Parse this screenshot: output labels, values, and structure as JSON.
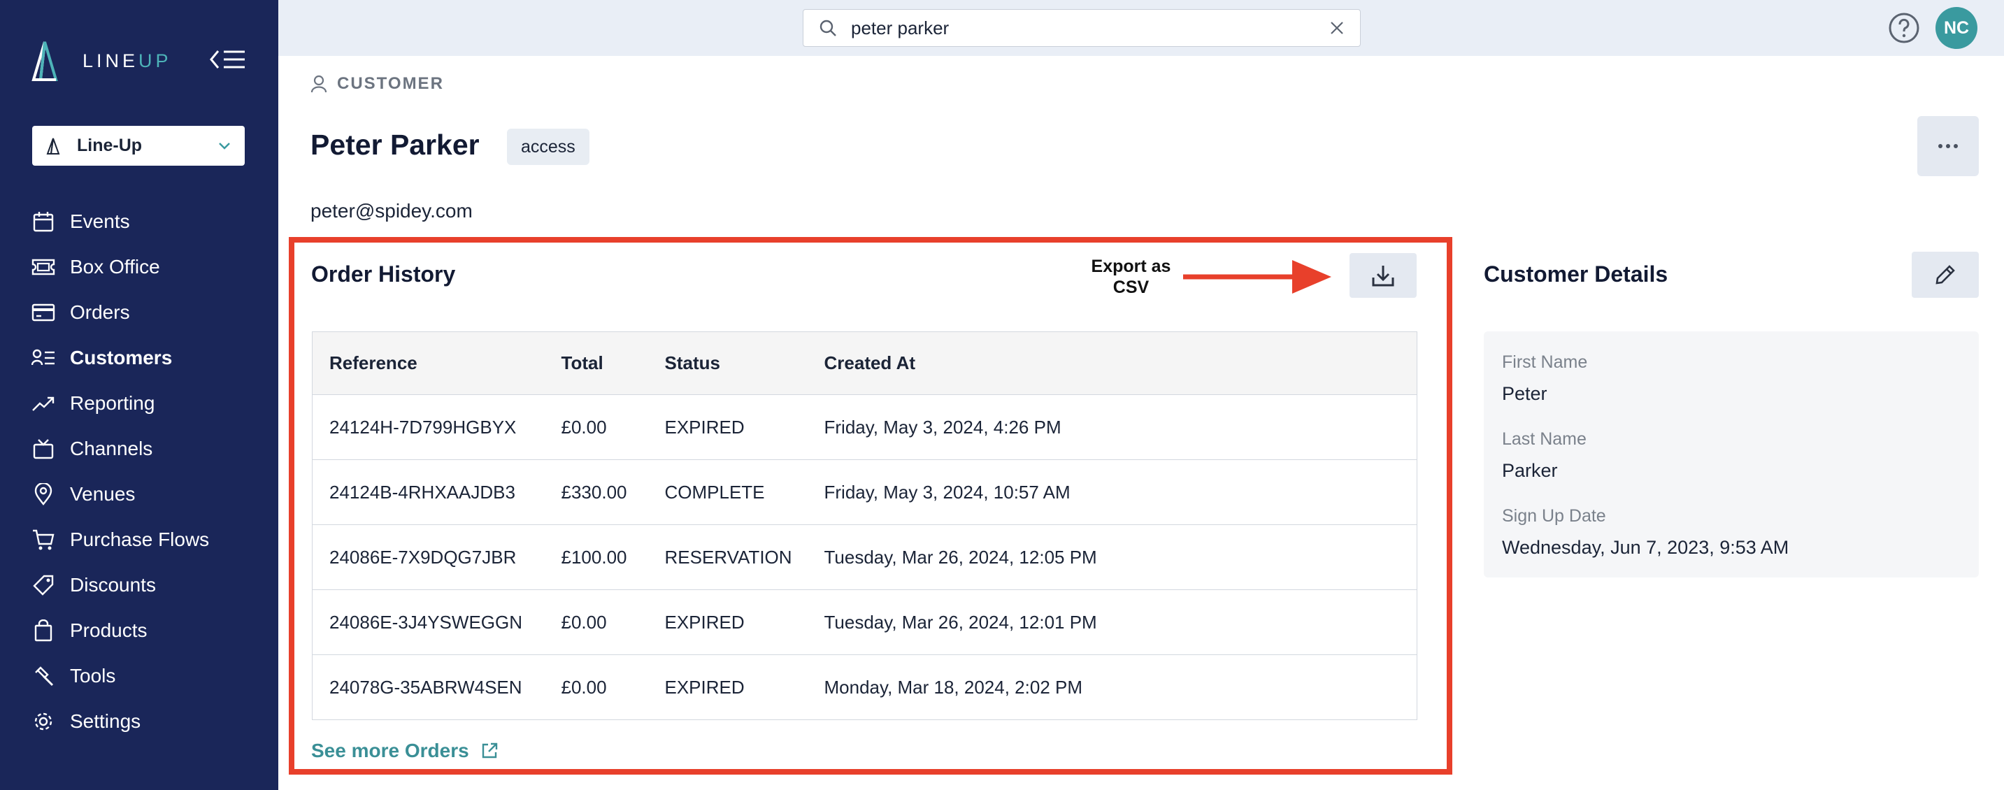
{
  "app": {
    "logo_line": "LINE",
    "logo_up": "UP"
  },
  "org_select": {
    "value": "Line-Up"
  },
  "nav": [
    {
      "label": "Events",
      "icon": "calendar-icon"
    },
    {
      "label": "Box Office",
      "icon": "ticket-icon"
    },
    {
      "label": "Orders",
      "icon": "credit-card-icon"
    },
    {
      "label": "Customers",
      "icon": "customers-icon",
      "active": true
    },
    {
      "label": "Reporting",
      "icon": "trend-chart-icon"
    },
    {
      "label": "Channels",
      "icon": "tv-icon"
    },
    {
      "label": "Venues",
      "icon": "map-pin-icon"
    },
    {
      "label": "Purchase Flows",
      "icon": "cart-icon"
    },
    {
      "label": "Discounts",
      "icon": "tag-icon"
    },
    {
      "label": "Products",
      "icon": "shopping-bag-icon"
    },
    {
      "label": "Tools",
      "icon": "hammer-icon"
    },
    {
      "label": "Settings",
      "icon": "gear-icon"
    }
  ],
  "search": {
    "value": "peter parker"
  },
  "user": {
    "initials": "NC"
  },
  "breadcrumb": "CUSTOMER",
  "customer": {
    "name": "Peter Parker",
    "tag": "access",
    "email": "peter@spidey.com"
  },
  "order_history": {
    "title": "Order History",
    "annotation": "Export as CSV",
    "columns": [
      "Reference",
      "Total",
      "Status",
      "Created At"
    ],
    "rows": [
      [
        "24124H-7D799HGBYX",
        "£0.00",
        "EXPIRED",
        "Friday, May 3, 2024, 4:26 PM"
      ],
      [
        "24124B-4RHXAAJDB3",
        "£330.00",
        "COMPLETE",
        "Friday, May 3, 2024, 10:57 AM"
      ],
      [
        "24086E-7X9DQG7JBR",
        "£100.00",
        "RESERVATION",
        "Tuesday, Mar 26, 2024, 12:05 PM"
      ],
      [
        "24086E-3J4YSWEGGN",
        "£0.00",
        "EXPIRED",
        "Tuesday, Mar 26, 2024, 12:01 PM"
      ],
      [
        "24078G-35ABRW4SEN",
        "£0.00",
        "EXPIRED",
        "Monday, Mar 18, 2024, 2:02 PM"
      ]
    ],
    "see_more": "See more Orders"
  },
  "customer_details": {
    "title": "Customer Details",
    "first_name_label": "First Name",
    "first_name": "Peter",
    "last_name_label": "Last Name",
    "last_name": "Parker",
    "signup_label": "Sign Up Date",
    "signup_date": "Wednesday, Jun 7, 2023, 9:53 AM"
  },
  "colors": {
    "sidebar": "#1a2659",
    "accent": "#3a9a9f",
    "highlight": "#e8402b",
    "topbar": "#e9eef6"
  }
}
